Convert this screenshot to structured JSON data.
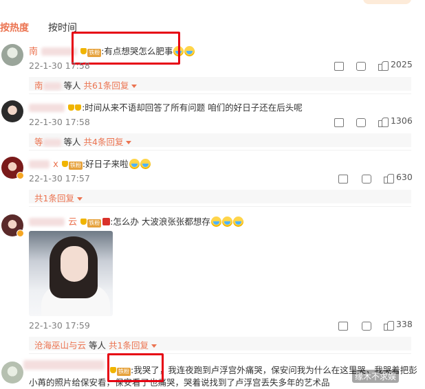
{
  "tabs": {
    "hot": "按热度",
    "time": "按时间"
  },
  "comments": [
    {
      "name": "南",
      "fan_badge": "铁粉",
      "text": ":有点想哭怎么肥事",
      "time": "22-1-30 17:58",
      "reply_names": "南",
      "reply_etc": "等人",
      "reply_count": "共61条回复",
      "likes": "2025"
    },
    {
      "name": "",
      "fan_badge": "",
      "text": ":时间从来不语却回答了所有问题 咱们的好日子还在后头呢",
      "time": "22-1-30 17:58",
      "reply_names": "等",
      "reply_etc": "等人",
      "reply_count": "共4条回复",
      "likes": "1306"
    },
    {
      "name": "x",
      "fan_badge": "铁粉",
      "text": ":好日子来啦",
      "time": "22-1-30 17:57",
      "reply_count": "共1条回复",
      "likes": "630"
    },
    {
      "name": "云",
      "fan_badge": "铁粉",
      "text": ":怎么办 大波浪张张都想存",
      "time": "22-1-30 17:59",
      "reply_names": "沧海巫山与云",
      "reply_etc": "等人",
      "reply_count": "共1条回复",
      "likes": "338"
    },
    {
      "name": "",
      "fan_badge": "铁粉",
      "text_line1": ":我哭了，我连夜跑到卢浮宫外痛哭，保安问我为什么在这里哭，我哭着把彭",
      "text_line2": "小苒的照片给保安看，保安看了也痛哭，哭着说找到了卢浮宫丢失多年的艺术品"
    }
  ],
  "watermark": "缘木不求娱"
}
